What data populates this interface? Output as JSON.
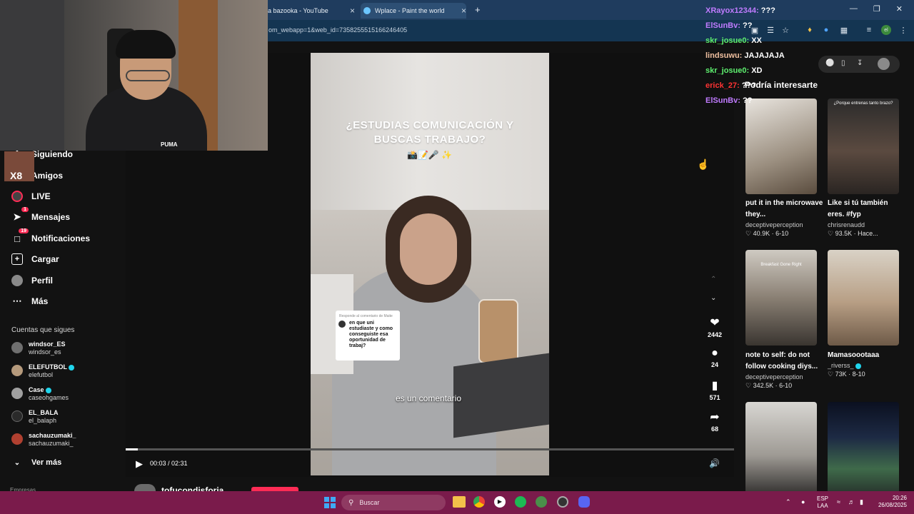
{
  "browser": {
    "tabs": [
      {
        "title": "a bazooka - YouTube",
        "close": "×"
      },
      {
        "title": "Wplace - Paint the world",
        "close": "×"
      }
    ],
    "new_tab": "+",
    "address": "om_webapp=1&web_id=7358255515166246405"
  },
  "sidebar": {
    "nav": [
      {
        "label": "Siguiendo",
        "icon": "following-icon"
      },
      {
        "label": "Amigos",
        "icon": "friends-icon"
      },
      {
        "label": "LIVE",
        "icon": "live-icon"
      },
      {
        "label": "Mensajes",
        "icon": "messages-icon",
        "badge": "1"
      },
      {
        "label": "Notificaciones",
        "icon": "notifications-icon",
        "badge": "19"
      },
      {
        "label": "Cargar",
        "icon": "upload-icon"
      },
      {
        "label": "Perfil",
        "icon": "profile-icon"
      },
      {
        "label": "Más",
        "icon": "more-icon"
      }
    ],
    "following_header": "Cuentas que sigues",
    "following": [
      {
        "name": "windsor_ES",
        "handle": "windsor_es",
        "verified": false
      },
      {
        "name": "ELEFUTBOL",
        "handle": "elefutbol",
        "verified": true
      },
      {
        "name": "Case",
        "handle": "caseohgames",
        "verified": true
      },
      {
        "name": "EL_BALA",
        "handle": "el_balaph",
        "verified": false
      },
      {
        "name": "sachauzumaki_",
        "handle": "sachauzumaki_",
        "verified": false
      }
    ],
    "see_more": "Ver más",
    "footer_cut": "Empresas"
  },
  "video": {
    "headline": "¿ESTUDIAS COMUNICACIÓN Y BUSCAS TRABAJO?",
    "subtitle": "es un comentario",
    "comment_card": {
      "reply_label": "Responde al comentario de Maite",
      "text": "en que uni estudiaste y como conseguiste esa oportunidad de trabaj?"
    },
    "time": "00:03 / 02:31",
    "progress": 0.02,
    "author_cut": "tofucondisforia",
    "actions": {
      "likes": "2442",
      "comments": "24",
      "saves": "571",
      "shares": "68"
    }
  },
  "recommendations": {
    "title": "Podría interesarte",
    "items": [
      {
        "title": "put it in the microwave they...",
        "author": "deceptiveperception",
        "views": "40.9K",
        "date": "6-10",
        "thumb_text": "",
        "verified": false
      },
      {
        "title": "Like si tú también eres. #fyp",
        "author": "chrisrenaudd",
        "views": "93.5K",
        "date": "Hace...",
        "thumb_text": "¿Porque entrenas tanto brazo?",
        "verified": false
      },
      {
        "title": "note to self: do not follow cooking diys...",
        "author": "deceptiveperception",
        "views": "342.5K",
        "date": "6-10",
        "thumb_text": "Breakfast Gone Right",
        "verified": false
      },
      {
        "title": "Mamasoootaaa",
        "author": "_riverss_",
        "views": "73K",
        "date": "8-10",
        "thumb_text": "",
        "verified": true
      },
      {
        "title": "",
        "author": "",
        "views": "",
        "date": "",
        "thumb_text": "",
        "verified": false
      },
      {
        "title": "",
        "author": "",
        "views": "",
        "date": "",
        "thumb_text": "",
        "verified": false
      }
    ]
  },
  "chat": [
    {
      "user": "XRayox12344:",
      "msg": "???",
      "color": "#c07bff"
    },
    {
      "user": "ElSunBv:",
      "msg": "??",
      "color": "#c07bff"
    },
    {
      "user": "skr_josue0:",
      "msg": "XX",
      "color": "#5ef06f"
    },
    {
      "user": "lindsuwu:",
      "msg": "JAJAJAJA",
      "color": "#f0c0a0"
    },
    {
      "user": "skr_josue0:",
      "msg": "XD",
      "color": "#5ef06f"
    },
    {
      "user": "erick_27:",
      "msg": "???",
      "color": "#ff3333"
    },
    {
      "user": "ElSunBv:",
      "msg": "??",
      "color": "#c07bff"
    }
  ],
  "webcam": {
    "brand": "PUMA",
    "overlay_badge": "X8"
  },
  "taskbar": {
    "search_placeholder": "Buscar",
    "lang": "ESP",
    "lang2": "LAA",
    "time": "20:26",
    "date": "26/08/2025"
  },
  "colors": {
    "accent": "#fe2c55",
    "taskbar": "#7a1b4b",
    "browser": "#1f3c5e"
  }
}
